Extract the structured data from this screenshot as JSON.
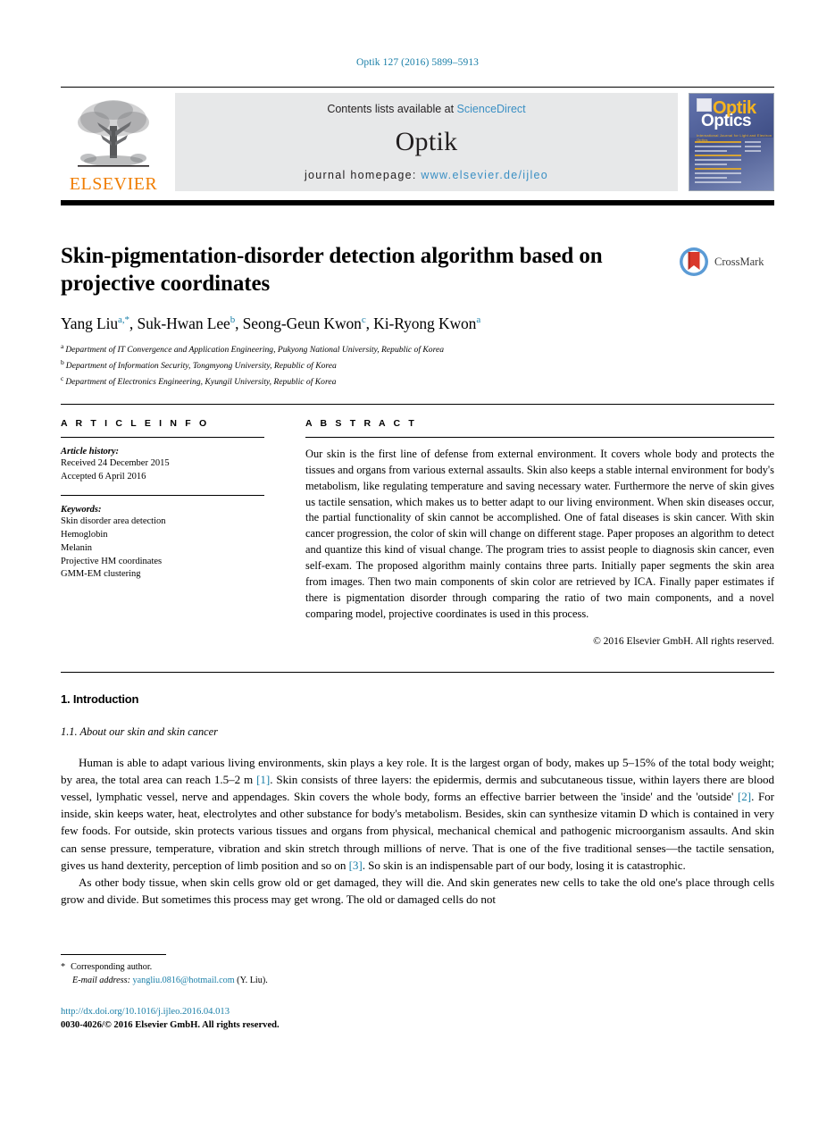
{
  "running_head": "Optik 127 (2016) 5899–5913",
  "masthead": {
    "publisher": "ELSEVIER",
    "contents_prefix": "Contents lists available at ",
    "contents_link": "ScienceDirect",
    "journal_name": "Optik",
    "homepage_prefix": "journal homepage: ",
    "homepage_url": "www.elsevier.de/ijleo",
    "cover": {
      "title_top": "Optik",
      "title_bottom": "Optics",
      "subtitle": "International Journal for Light and Electron Optics"
    },
    "link_color": "#3a8fc4"
  },
  "article": {
    "title": "Skin-pigmentation-disorder detection algorithm based on projective coordinates",
    "crossmark_label": "CrossMark",
    "authors": [
      {
        "name": "Yang Liu",
        "marks": "a,*"
      },
      {
        "name": "Suk-Hwan Lee",
        "marks": "b"
      },
      {
        "name": "Seong-Geun Kwon",
        "marks": "c"
      },
      {
        "name": "Ki-Ryong Kwon",
        "marks": "a"
      }
    ],
    "affiliations": [
      {
        "mark": "a",
        "text": "Department of IT Convergence and Application Engineering, Pukyong National University, Republic of Korea"
      },
      {
        "mark": "b",
        "text": "Department of Information Security, Tongmyong University, Republic of Korea"
      },
      {
        "mark": "c",
        "text": "Department of Electronics Engineering, Kyungil University, Republic of Korea"
      }
    ]
  },
  "info": {
    "heading": "A R T I C L E   I N F O",
    "history_label": "Article history:",
    "history": [
      "Received 24 December 2015",
      "Accepted 6 April 2016"
    ],
    "keywords_label": "Keywords:",
    "keywords": [
      "Skin disorder area detection",
      "Hemoglobin",
      "Melanin",
      "Projective HM coordinates",
      "GMM-EM clustering"
    ]
  },
  "abstract": {
    "heading": "A B S T R A C T",
    "text": "Our skin is the first line of defense from external environment. It covers whole body and protects the tissues and organs from various external assaults. Skin also keeps a stable internal environment for body's metabolism, like regulating temperature and saving necessary water. Furthermore the nerve of skin gives us tactile sensation, which makes us to better adapt to our living environment. When skin diseases occur, the partial functionality of skin cannot be accomplished. One of fatal diseases is skin cancer. With skin cancer progression, the color of skin will change on different stage. Paper proposes an algorithm to detect and quantize this kind of visual change. The program tries to assist people to diagnosis skin cancer, even self-exam. The proposed algorithm mainly contains three parts. Initially paper segments the skin area from images. Then two main components of skin color are retrieved by ICA. Finally paper estimates if there is pigmentation disorder through comparing the ratio of two main components, and a novel comparing model, projective coordinates is used in this process.",
    "copyright": "© 2016 Elsevier GmbH. All rights reserved."
  },
  "body": {
    "section_number_title": "1.  Introduction",
    "subsection_title": "1.1.  About our skin and skin cancer",
    "paragraph1_part1": "Human is able to adapt various living environments, skin plays a key role. It is the largest organ of body, makes up 5–15% of the total body weight; by area, the total area can reach  1.5–2 m ",
    "cite1": "[1]",
    "paragraph1_part2": ". Skin consists of three layers: the epidermis, dermis and subcutaneous tissue, within layers there are blood vessel, lymphatic vessel, nerve and appendages. Skin covers the whole body, forms an effective barrier between the 'inside' and the 'outside' ",
    "cite2": "[2]",
    "paragraph1_part3": ". For inside, skin keeps water, heat, electrolytes and other substance for body's metabolism. Besides, skin can synthesize vitamin D which is contained in very few foods. For outside, skin protects various tissues and organs from physical, mechanical chemical and pathogenic microorganism assaults. And skin can sense pressure, temperature, vibration and skin stretch through millions of nerve. That is one of the five traditional senses—the tactile sensation, gives us hand dexterity, perception of limb position and so on ",
    "cite3": "[3]",
    "paragraph1_part4": ". So skin is an indispensable part of our body, losing it is catastrophic.",
    "paragraph2": "As other body tissue, when skin cells grow old or get damaged, they will die. And skin generates new cells to take the old one's place through cells grow and divide. But sometimes this process may get wrong. The old or damaged cells do not"
  },
  "footer": {
    "star": "*",
    "corresponding": "Corresponding author.",
    "email_label": "E-mail address:",
    "email": "yangliu.0816@hotmail.com",
    "email_suffix": "(Y. Liu).",
    "doi": "http://dx.doi.org/10.1016/j.ijleo.2016.04.013",
    "issn": "0030-4026/© 2016 Elsevier GmbH. All rights reserved."
  }
}
